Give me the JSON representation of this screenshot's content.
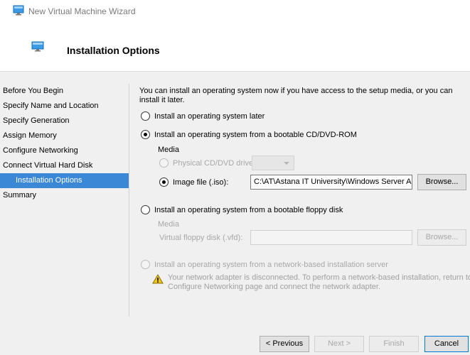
{
  "window": {
    "title": "New Virtual Machine Wizard",
    "icon": "monitor-icon"
  },
  "header": {
    "title": "Installation Options",
    "icon": "monitor-icon"
  },
  "sidebar": {
    "items": [
      {
        "label": "Before You Begin"
      },
      {
        "label": "Specify Name and Location"
      },
      {
        "label": "Specify Generation"
      },
      {
        "label": "Assign Memory"
      },
      {
        "label": "Configure Networking"
      },
      {
        "label": "Connect Virtual Hard Disk"
      },
      {
        "label": "Installation Options",
        "active": true
      },
      {
        "label": "Summary"
      }
    ],
    "active_color": "#3a88d6"
  },
  "content": {
    "intro": "You can install an operating system now if you have access to the setup media, or you can install it later.",
    "option_later": {
      "label": "Install an operating system later",
      "checked": false
    },
    "option_cd": {
      "label": "Install an operating system from a bootable CD/DVD-ROM",
      "checked": true,
      "media_label": "Media",
      "physical_drive": {
        "label": "Physical CD/DVD drive:",
        "checked": false,
        "enabled": false,
        "value": ""
      },
      "image_file": {
        "label": "Image file (.iso):",
        "checked": true,
        "value": "C:\\AT\\Astana IT University\\Windows Server Admin",
        "browse_label": "Browse..."
      }
    },
    "option_floppy": {
      "label": "Install an operating system from a bootable floppy disk",
      "checked": false,
      "media_label": "Media",
      "vfd_label": "Virtual floppy disk (.vfd):",
      "vfd_value": "",
      "browse_label": "Browse..."
    },
    "option_network": {
      "label": "Install an operating system from a network-based installation server",
      "checked": false,
      "enabled": false,
      "warning_line1": "Your network adapter is disconnected. To perform a network-based installation, return to the",
      "warning_line2": "Configure Networking page and connect the network adapter.",
      "warning_icon": "warning-icon"
    }
  },
  "footer": {
    "previous_label": "< Previous",
    "next_label": "Next >",
    "finish_label": "Finish",
    "cancel_label": "Cancel"
  }
}
